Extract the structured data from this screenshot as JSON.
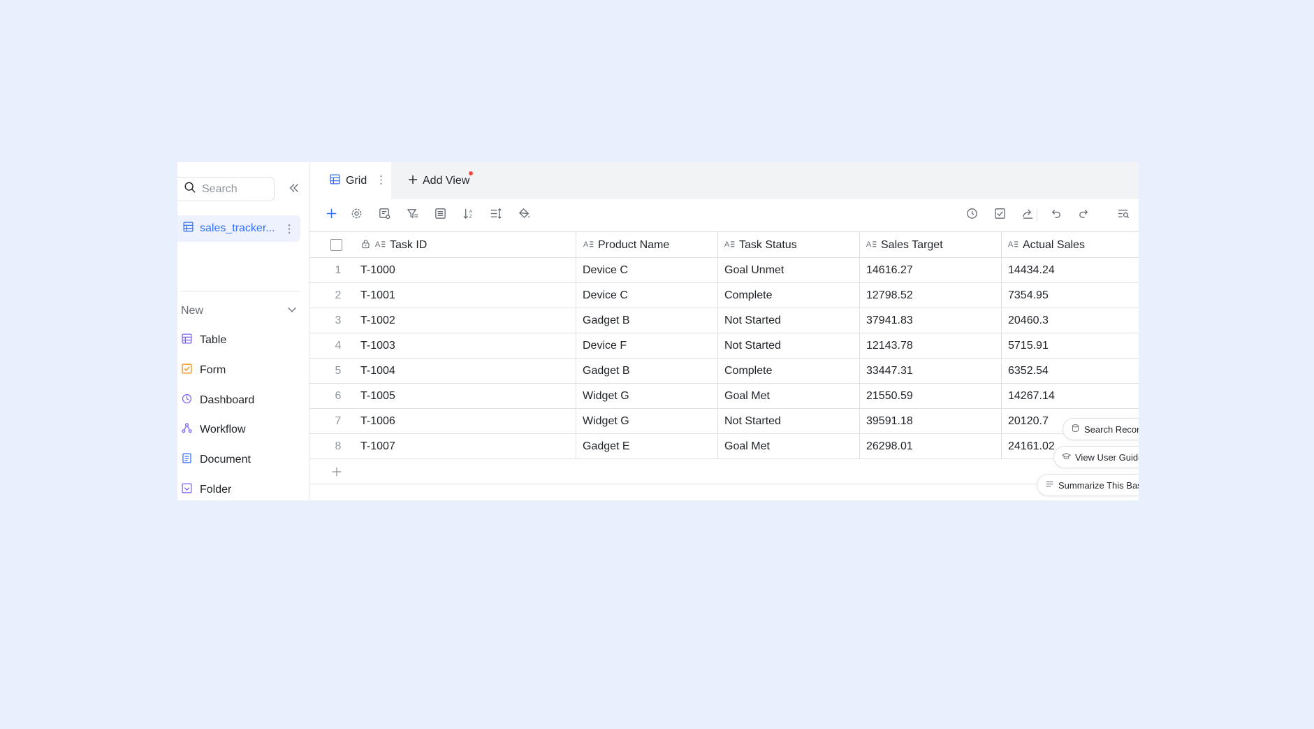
{
  "sidebar": {
    "search_placeholder": "Search",
    "file_name": "sales_tracker...",
    "new_label": "New",
    "menu": [
      {
        "label": "Table",
        "icon": "table-icon"
      },
      {
        "label": "Form",
        "icon": "form-icon"
      },
      {
        "label": "Dashboard",
        "icon": "dashboard-icon"
      },
      {
        "label": "Workflow",
        "icon": "workflow-icon"
      },
      {
        "label": "Document",
        "icon": "document-icon"
      },
      {
        "label": "Folder",
        "icon": "folder-icon"
      }
    ]
  },
  "tabs": {
    "grid_label": "Grid",
    "add_view_label": "Add View"
  },
  "table": {
    "columns": [
      "Task ID",
      "Product Name",
      "Task Status",
      "Sales Target",
      "Actual Sales"
    ],
    "rows": [
      {
        "n": "1",
        "id": "T-1000",
        "product": "Device C",
        "status": "Goal Unmet",
        "target": "14616.27",
        "actual": "14434.24"
      },
      {
        "n": "2",
        "id": "T-1001",
        "product": "Device C",
        "status": "Complete",
        "target": "12798.52",
        "actual": "7354.95"
      },
      {
        "n": "3",
        "id": "T-1002",
        "product": "Gadget B",
        "status": "Not Started",
        "target": "37941.83",
        "actual": "20460.3"
      },
      {
        "n": "4",
        "id": "T-1003",
        "product": "Device F",
        "status": "Not Started",
        "target": "12143.78",
        "actual": "5715.91"
      },
      {
        "n": "5",
        "id": "T-1004",
        "product": "Gadget B",
        "status": "Complete",
        "target": "33447.31",
        "actual": "6352.54"
      },
      {
        "n": "6",
        "id": "T-1005",
        "product": "Widget G",
        "status": "Goal Met",
        "target": "21550.59",
        "actual": "14267.14"
      },
      {
        "n": "7",
        "id": "T-1006",
        "product": "Widget G",
        "status": "Not Started",
        "target": "39591.18",
        "actual": "20120.7"
      },
      {
        "n": "8",
        "id": "T-1007",
        "product": "Gadget E",
        "status": "Goal Met",
        "target": "26298.01",
        "actual": "24161.02"
      }
    ]
  },
  "floating": {
    "search_records": "Search Record",
    "view_user_guide": "View User Guide",
    "summarize": "Summarize This Bas"
  },
  "colors": {
    "accent": "#3370ff",
    "background": "#e8effd",
    "red_dot": "#f54a45"
  }
}
